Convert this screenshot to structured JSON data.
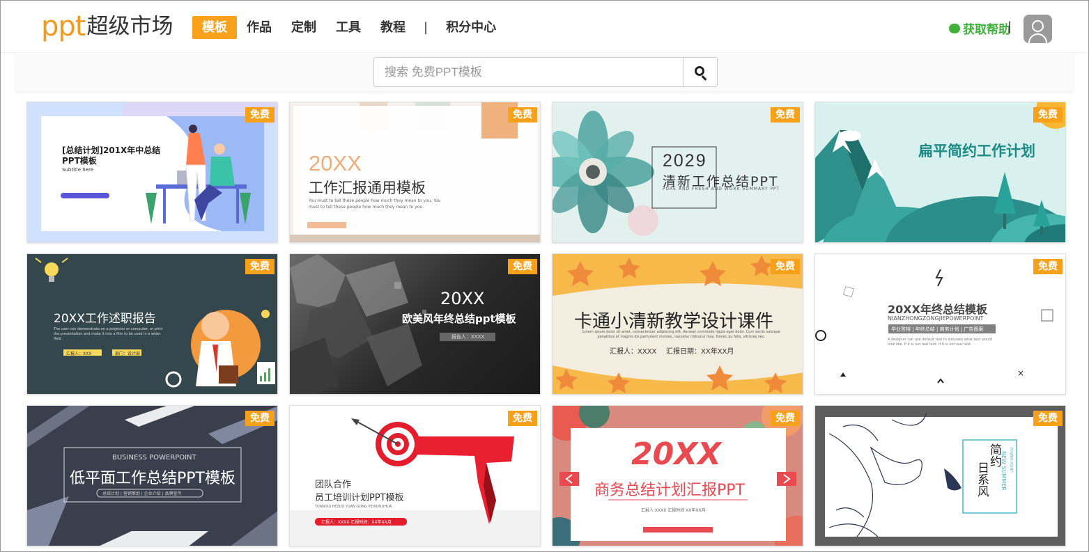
{
  "header": {
    "logo_latin": "ppt",
    "logo_cjk": "超级市场",
    "nav": [
      {
        "label": "模板",
        "active": true
      },
      {
        "label": "作品",
        "active": false
      },
      {
        "label": "定制",
        "active": false
      },
      {
        "label": "工具",
        "active": false
      },
      {
        "label": "教程",
        "active": false
      },
      {
        "label": "|",
        "separator": true
      },
      {
        "label": "积分中心",
        "active": false
      }
    ],
    "help_label": "获取帮助",
    "separator": "|",
    "avatar_icon": "user-icon"
  },
  "search": {
    "placeholder": "搜索 免费PPT模板",
    "value": "",
    "icon": "search-icon"
  },
  "colors": {
    "accent": "#f8a11a",
    "help": "#3fb13a"
  },
  "badge_label": "免费",
  "cards": [
    {
      "line1": "[总结计划]201X年中总结",
      "line2": "PPT模板",
      "line3": "Subtitle here",
      "body": ""
    },
    {
      "line1": "20XX",
      "line2": "工作汇报通用模板",
      "line3": "You must to tell these people how much they mean to you. You must to tell these people how much they mean to you.",
      "body": ""
    },
    {
      "line1": "2029",
      "line2": "清新工作总结PPT",
      "line3": "PURE AND FRESH AND WORK SUMMARY PPT",
      "body": ""
    },
    {
      "line1": "扁平简约工作计划",
      "line2": "",
      "line3": "",
      "body": ""
    },
    {
      "line1": "20XX工作述职报告",
      "line2": "The user can demonstrate on a projector or computer, or print the presentation and make it into a film to be used in a wider field",
      "line3": "汇报人：XXX",
      "body": "部门：设计部"
    },
    {
      "line1": "20XX",
      "line2": "欧美风年终总结ppt模板",
      "line3": "报告人：XXXX",
      "body": ""
    },
    {
      "line1": "卡通小清新教学设计课件",
      "line2": "Lorem ipsum dolor sit amet, consectetuer adipiscing elit. Aenean commodo ligula eget dolor. Cum sociis natoque penatibus et magnis dis parturient montes, nascetur ridiculus mus. Donec qu felis, ultricies nec.",
      "line3": "汇报人：XXXX",
      "body": "汇报日期：XX年XX月"
    },
    {
      "line1": "20XX年终总结模板",
      "line2": "NIANZHONGZONGJIEPOWERPOINT",
      "line3": "毕业答辩 | 年终总结 | 商务计划 | 广告图案",
      "body": "A designer can use default text to simulate what text would look like. If it is not real text. If it is not real text."
    },
    {
      "line1": "BUSINESS POWERPOINT",
      "line2": "低平面工作总结PPT模板",
      "line3": "总结计划 | 营销策划 | 企业介绍 | 品牌宣传",
      "body": ""
    },
    {
      "line1": "团队合作",
      "line2": "员工培训计划PPT模板",
      "line3": "TUANDUI HEZUO YUAN GONG PEIXUN JIHUA",
      "body": "汇报人：XXXX 汇报时间：XX年XX月"
    },
    {
      "line1": "20XX",
      "line2": "商务总结计划汇报PPT",
      "line3": "汇报人 XXXX 汇报时间 XX年XX月",
      "body": ""
    },
    {
      "line1": "简约",
      "line2": "日系风",
      "line3": "NEW SUMMER",
      "body": "POWER POINT"
    }
  ]
}
